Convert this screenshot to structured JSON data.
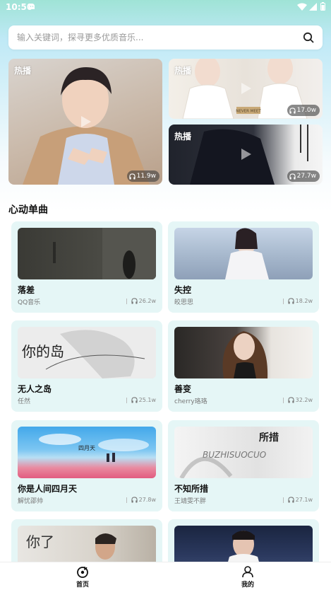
{
  "status_bar": {
    "time": "10:50"
  },
  "search": {
    "placeholder": "输入关键词，探寻更多优质音乐..."
  },
  "hot": [
    {
      "label": "热播",
      "count": "11.9w"
    },
    {
      "label": "热播",
      "count": "17.0w"
    },
    {
      "label": "热播",
      "count": "27.7w"
    }
  ],
  "section_title": "心动单曲",
  "songs": [
    {
      "title": "落差",
      "artist": "QQ音乐",
      "count": "26.2w"
    },
    {
      "title": "失控",
      "artist": "皎思思",
      "count": "18.2w"
    },
    {
      "title": "无人之岛",
      "artist": "任然",
      "count": "25.1w"
    },
    {
      "title": "善变",
      "artist": "cherry珞珞",
      "count": "32.2w"
    },
    {
      "title": "你是人间四月天",
      "artist": "解忧邵帅",
      "count": "27.8w"
    },
    {
      "title": "不知所措",
      "artist": "王靖雯不胖",
      "count": "27.1w"
    },
    {
      "title": "",
      "artist": "",
      "count": ""
    },
    {
      "title": "",
      "artist": "",
      "count": ""
    }
  ],
  "covers": {
    "c3": "你的岛",
    "c4": "四月天",
    "c5": "所措",
    "c6": "BUZHISUOCUO",
    "c7": "你了",
    "c_nevermeet": "NEVER MEET"
  },
  "nav": {
    "home": "首页",
    "mine": "我的"
  },
  "colors": {
    "card_bg": "#e5f6f6",
    "accent_top": "#9fe3d6"
  }
}
